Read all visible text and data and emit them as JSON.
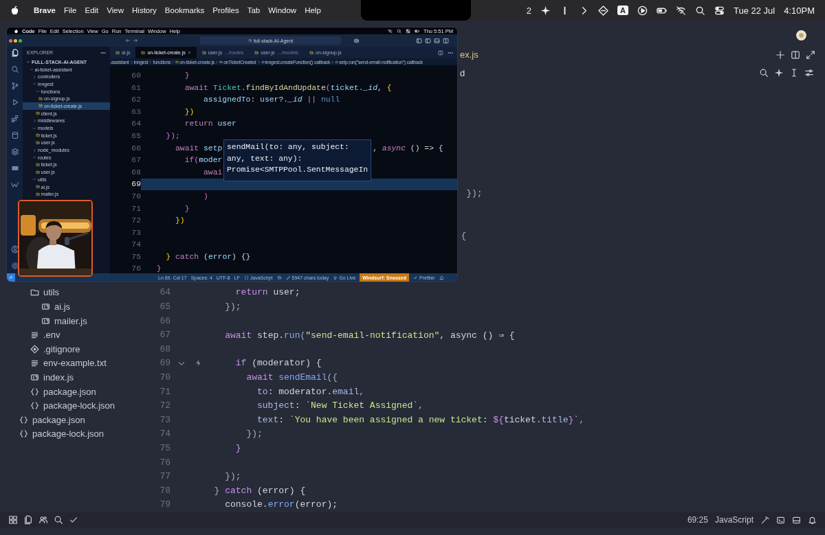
{
  "menubar": {
    "app": "Brave",
    "menus": [
      "File",
      "Edit",
      "View",
      "History",
      "Bookmarks",
      "Profiles",
      "Tab",
      "Window",
      "Help"
    ],
    "status": [
      {
        "kind": "text",
        "text": "2"
      },
      {
        "kind": "sparkle"
      },
      {
        "kind": "bar"
      },
      {
        "kind": "chevron"
      },
      {
        "kind": "diamond"
      },
      {
        "kind": "badge",
        "text": "A"
      },
      {
        "kind": "play"
      },
      {
        "kind": "battery"
      },
      {
        "kind": "wifi-off"
      },
      {
        "kind": "search"
      },
      {
        "kind": "controls"
      }
    ],
    "date": "Tue 22 Jul",
    "time": "4:10PM"
  },
  "editor": {
    "tab_fragment": "ex.js",
    "breadcrumb_fragment": "d",
    "tree": [
      {
        "children": [
          {
            "name": "utils",
            "kind": "folder",
            "expanded": true,
            "children": [
              {
                "name": "ai.js",
                "kind": "js"
              },
              {
                "name": "mailer.js",
                "kind": "js"
              }
            ]
          },
          {
            "name": ".env",
            "kind": "env"
          },
          {
            "name": ".gitignore",
            "kind": "git"
          },
          {
            "name": "env-example.txt",
            "kind": "text"
          },
          {
            "name": "index.js",
            "kind": "js"
          },
          {
            "name": "package.json",
            "kind": "json"
          },
          {
            "name": "package-lock.json",
            "kind": "json"
          }
        ]
      },
      {
        "name": "package.json",
        "kind": "json"
      },
      {
        "name": "package-lock.json",
        "kind": "json"
      }
    ],
    "lines": [
      {
        "code": [
          {
            "text": "                                                 });",
            "kind": "punct"
          }
        ],
        "foldable": false,
        "hint": false
      },
      {
        "foldable": false,
        "hint": false
      },
      {
        "foldable": false,
        "hint": false
      },
      {
        "code": [
          {
            "text": "                                                {",
            "kind": "punct"
          }
        ],
        "foldable": false,
        "hint": false
      },
      {
        "foldable": false,
        "hint": false
      },
      {
        "foldable": false,
        "hint": false
      },
      {
        "foldable": false,
        "hint": false
      },
      {
        "number": "64",
        "code": [
          {
            "text": "      return",
            "kind": "kw"
          },
          {
            "text": " user;",
            "kind": "plain"
          }
        ],
        "foldable": false,
        "hint": false
      },
      {
        "number": "65",
        "code": [
          {
            "text": "    });",
            "kind": "punct"
          }
        ],
        "foldable": false,
        "hint": false
      },
      {
        "number": "66",
        "foldable": false,
        "hint": false
      },
      {
        "number": "67",
        "code": [
          {
            "text": "    await",
            "kind": "kw"
          },
          {
            "text": " step.",
            "kind": "plain"
          },
          {
            "text": "run",
            "kind": "fn"
          },
          {
            "text": "(",
            "kind": "punct"
          },
          {
            "text": "\"send-email-notification\"",
            "kind": "str"
          },
          {
            "text": ", async () ⇒ {",
            "kind": "plain"
          }
        ],
        "foldable": false,
        "hint": false
      },
      {
        "number": "68",
        "foldable": false,
        "hint": false
      },
      {
        "number": "69",
        "code": [
          {
            "text": "      if",
            "kind": "kw"
          },
          {
            "text": " (moderator) {",
            "kind": "plain"
          }
        ],
        "foldable": true,
        "hint": true
      },
      {
        "number": "70",
        "code": [
          {
            "text": "        await",
            "kind": "kw"
          },
          {
            "text": " sendEmail",
            "kind": "fn"
          },
          {
            "text": "({",
            "kind": "punct"
          }
        ],
        "foldable": false,
        "hint": false
      },
      {
        "number": "71",
        "code": [
          {
            "text": "          to",
            "kind": "prop"
          },
          {
            "text": ": moderator.",
            "kind": "plain"
          },
          {
            "text": "email",
            "kind": "prop"
          },
          {
            "text": ",",
            "kind": "punct"
          }
        ],
        "foldable": false,
        "hint": false
      },
      {
        "number": "72",
        "code": [
          {
            "text": "          subject",
            "kind": "prop"
          },
          {
            "text": ": ",
            "kind": "plain"
          },
          {
            "text": "`New Ticket Assigned`",
            "kind": "str"
          },
          {
            "text": ",",
            "kind": "punct"
          }
        ],
        "foldable": false,
        "hint": false
      },
      {
        "number": "73",
        "code": [
          {
            "text": "          text",
            "kind": "prop"
          },
          {
            "text": ": ",
            "kind": "plain"
          },
          {
            "text": "`You have been assigned a new ticket: ",
            "kind": "str"
          },
          {
            "text": "${",
            "kind": "brace"
          },
          {
            "text": "ticket.",
            "kind": "plain"
          },
          {
            "text": "title",
            "kind": "prop"
          },
          {
            "text": "}",
            "kind": "brace"
          },
          {
            "text": "`",
            "kind": "str"
          },
          {
            "text": ",",
            "kind": "punct"
          }
        ],
        "foldable": false,
        "hint": false
      },
      {
        "number": "74",
        "code": [
          {
            "text": "        });",
            "kind": "punct"
          }
        ],
        "foldable": false,
        "hint": false
      },
      {
        "number": "75",
        "code": [
          {
            "text": "      }",
            "kind": "brace"
          }
        ],
        "foldable": false,
        "hint": false
      },
      {
        "number": "76",
        "foldable": false,
        "hint": false
      },
      {
        "number": "77",
        "code": [
          {
            "text": "    });",
            "kind": "punct"
          }
        ],
        "foldable": false,
        "hint": false
      },
      {
        "number": "78",
        "code": [
          {
            "text": "  } ",
            "kind": "punct"
          },
          {
            "text": "catch",
            "kind": "kw"
          },
          {
            "text": " (error) {",
            "kind": "plain"
          }
        ],
        "foldable": false,
        "hint": false
      },
      {
        "number": "79",
        "code": [
          {
            "text": "    console.",
            "kind": "plain"
          },
          {
            "text": "error",
            "kind": "fn"
          },
          {
            "text": "(error);",
            "kind": "plain"
          }
        ],
        "foldable": false,
        "hint": false
      }
    ],
    "status": {
      "cursor": "69:25",
      "language": "JavaScript"
    }
  },
  "overlay": {
    "menubar": {
      "app": "Code",
      "menus": [
        "File",
        "Edit",
        "Selection",
        "View",
        "Go",
        "Run",
        "Terminal",
        "Window",
        "Help"
      ],
      "clock": "Thu 5:51 PM"
    },
    "search": "full-stack-AI-Agent",
    "activity": [
      {
        "kind": "files",
        "selected": true
      },
      {
        "kind": "search",
        "selected": false
      },
      {
        "kind": "branch",
        "selected": false
      },
      {
        "kind": "run",
        "selected": false
      },
      {
        "kind": "blocks",
        "selected": false
      },
      {
        "kind": "database",
        "selected": false
      },
      {
        "kind": "layers",
        "selected": false
      },
      {
        "kind": "panel",
        "selected": false
      },
      {
        "kind": "wave",
        "selected": false
      }
    ],
    "activity_bottom": [
      {
        "kind": "account",
        "selected": false
      },
      {
        "kind": "gear",
        "selected": false
      }
    ],
    "explorer": {
      "title": "EXPLORER",
      "tree": [
        {
          "name": "FULL-STACK-AI-AGENT",
          "kind": "root",
          "expanded": true,
          "selected": false,
          "children": [
            {
              "name": "ai-ticket-assistant",
              "kind": "folder",
              "expanded": true,
              "selected": false,
              "children": [
                {
                  "name": "controllers",
                  "kind": "folder",
                  "expanded": false,
                  "selected": false
                },
                {
                  "name": "inngest",
                  "kind": "folder",
                  "expanded": true,
                  "selected": false,
                  "children": [
                    {
                      "name": "functions",
                      "kind": "folder",
                      "expanded": true,
                      "selected": false,
                      "children": [
                        {
                          "name": "on-signup.js",
                          "kind": "js",
                          "selected": false
                        },
                        {
                          "name": "on-ticket-create.js",
                          "kind": "js",
                          "selected": true
                        }
                      ]
                    },
                    {
                      "name": "client.js",
                      "kind": "js",
                      "selected": false
                    }
                  ]
                },
                {
                  "name": "middlewares",
                  "kind": "folder",
                  "expanded": false,
                  "selected": false
                },
                {
                  "name": "models",
                  "kind": "folder",
                  "expanded": true,
                  "selected": false,
                  "children": [
                    {
                      "name": "ticket.js",
                      "kind": "js",
                      "selected": false
                    },
                    {
                      "name": "user.js",
                      "kind": "js",
                      "selected": false
                    }
                  ]
                },
                {
                  "name": "node_modules",
                  "kind": "folder",
                  "expanded": false,
                  "selected": false
                },
                {
                  "name": "routes",
                  "kind": "folder",
                  "expanded": true,
                  "selected": false,
                  "children": [
                    {
                      "name": "ticket.js",
                      "kind": "js",
                      "selected": false
                    },
                    {
                      "name": "user.js",
                      "kind": "js",
                      "selected": false
                    }
                  ]
                },
                {
                  "name": "utils",
                  "kind": "folder",
                  "expanded": true,
                  "selected": false,
                  "children": [
                    {
                      "name": "ai.js",
                      "kind": "js",
                      "selected": false
                    },
                    {
                      "name": "mailer.js",
                      "kind": "js",
                      "selected": false
                    }
                  ]
                }
              ]
            }
          ]
        }
      ]
    },
    "tabs": [
      {
        "name": "ai.js",
        "selected": false
      },
      {
        "name": "on-ticket-create.js",
        "selected": true
      },
      {
        "name": "user.js",
        "detail": "…/routes",
        "selected": false
      },
      {
        "name": "user.js",
        "detail": "…/models",
        "selected": false
      },
      {
        "name": "on-signup.js",
        "selected": false
      }
    ],
    "breadcrumb": [
      {
        "text": "-assistant",
        "kind": "folder"
      },
      {
        "text": "inngest",
        "kind": "folder"
      },
      {
        "text": "functions",
        "kind": "folder"
      },
      {
        "text": "on-ticket-create.js",
        "kind": "file"
      },
      {
        "text": "onTicketCreated",
        "kind": "variable"
      },
      {
        "text": "inngest.createFunction() callback",
        "kind": "method"
      },
      {
        "text": "setp.run(\"send-email-notification\") callback",
        "kind": "method"
      }
    ],
    "lines": [
      {
        "number": "60",
        "code": [
          {
            "text": "        }",
            "kind": "brace2"
          }
        ],
        "current": false
      },
      {
        "number": "61",
        "code": [
          {
            "text": "        await",
            "kind": "kw"
          },
          {
            "text": " Ticket",
            "kind": "cls"
          },
          {
            "text": ".",
            "kind": "plain"
          },
          {
            "text": "findByIdAndUpdate",
            "kind": "fn"
          },
          {
            "text": "(",
            "kind": "brace2"
          },
          {
            "text": "ticket",
            "kind": "var"
          },
          {
            "text": ".",
            "kind": "plain"
          },
          {
            "text": "_id",
            "kind": "ital"
          },
          {
            "text": ", ",
            "kind": "plain"
          },
          {
            "text": "{",
            "kind": "brace"
          }
        ],
        "current": false
      },
      {
        "number": "62",
        "code": [
          {
            "text": "            assignedTo",
            "kind": "var"
          },
          {
            "text": ": ",
            "kind": "plain"
          },
          {
            "text": "user",
            "kind": "var"
          },
          {
            "text": "?.",
            "kind": "plain"
          },
          {
            "text": "_id",
            "kind": "ital"
          },
          {
            "text": " || ",
            "kind": "kw"
          },
          {
            "text": "null",
            "kind": "const"
          }
        ],
        "current": false
      },
      {
        "number": "63",
        "code": [
          {
            "text": "        })",
            "kind": "brace"
          }
        ],
        "current": false
      },
      {
        "number": "64",
        "code": [
          {
            "text": "        return",
            "kind": "kw"
          },
          {
            "text": " user",
            "kind": "var"
          }
        ],
        "current": false
      },
      {
        "number": "65",
        "code": [
          {
            "text": "    });",
            "kind": "brace2"
          }
        ],
        "current": false
      },
      {
        "number": "66",
        "code": [
          {
            "text": "      await",
            "kind": "kw"
          },
          {
            "text": " setp",
            "kind": "var"
          },
          {
            "text": "                                , ",
            "kind": "plain"
          },
          {
            "text": "async",
            "kind": "italkw"
          },
          {
            "text": " () => {",
            "kind": "plain"
          }
        ],
        "current": false
      },
      {
        "number": "67",
        "code": [
          {
            "text": "        if",
            "kind": "kw"
          },
          {
            "text": "(",
            "kind": "brace2"
          },
          {
            "text": "moder",
            "kind": "var"
          }
        ],
        "current": false
      },
      {
        "number": "68",
        "code": [
          {
            "text": "            awai",
            "kind": "kw"
          }
        ],
        "current": false
      },
      {
        "number": "69",
        "current": true
      },
      {
        "number": "70",
        "code": [
          {
            "text": "            )",
            "kind": "brace2"
          }
        ],
        "current": false
      },
      {
        "number": "71",
        "code": [
          {
            "text": "        }",
            "kind": "brace2"
          }
        ],
        "current": false
      },
      {
        "number": "72",
        "code": [
          {
            "text": "      })",
            "kind": "brace"
          }
        ],
        "current": false
      },
      {
        "number": "73",
        "current": false
      },
      {
        "number": "74",
        "current": false
      },
      {
        "number": "75",
        "code": [
          {
            "text": "    } ",
            "kind": "brace"
          },
          {
            "text": "catch",
            "kind": "kw"
          },
          {
            "text": " (",
            "kind": "plain"
          },
          {
            "text": "error",
            "kind": "var"
          },
          {
            "text": ") {}",
            "kind": "plain"
          }
        ],
        "current": false
      },
      {
        "number": "76",
        "code": [
          {
            "text": "  }",
            "kind": "brace2"
          }
        ],
        "current": false
      }
    ],
    "hover": "sendMail(to: any, subject: any, text: any): Promise<SMTPPool.SentMessageIn",
    "status": [
      {
        "kind": "text",
        "text": "Ln 69, Col 17"
      },
      {
        "kind": "text",
        "text": "Spaces: 4"
      },
      {
        "kind": "text",
        "text": "UTF-8"
      },
      {
        "kind": "text",
        "text": "LF"
      },
      {
        "kind": "language",
        "text": "JavaScript"
      },
      {
        "kind": "copilot"
      },
      {
        "kind": "pen",
        "text": "5947 chars today"
      },
      {
        "kind": "broadcast",
        "text": "Go Live"
      },
      {
        "kind": "warning",
        "text": "Windsurf: Snoozed"
      },
      {
        "kind": "checks",
        "text": "Prettier"
      },
      {
        "kind": "bell"
      }
    ]
  }
}
